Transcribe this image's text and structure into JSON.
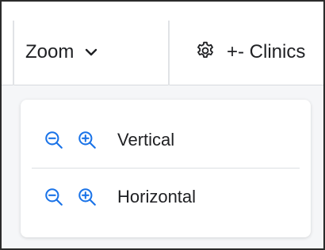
{
  "toolbar": {
    "zoom_label": "Zoom",
    "zoom_icon": "chevron-down-icon",
    "clinics_label": "+- Clinics",
    "clinics_icon": "gear-icon"
  },
  "zoom_panel": {
    "icon_color": "#1a73e8",
    "rows": [
      {
        "label": "Vertical",
        "zoom_out_icon": "zoom-out-icon",
        "zoom_in_icon": "zoom-in-icon"
      },
      {
        "label": "Horizontal",
        "zoom_out_icon": "zoom-out-icon",
        "zoom_in_icon": "zoom-in-icon"
      }
    ]
  }
}
